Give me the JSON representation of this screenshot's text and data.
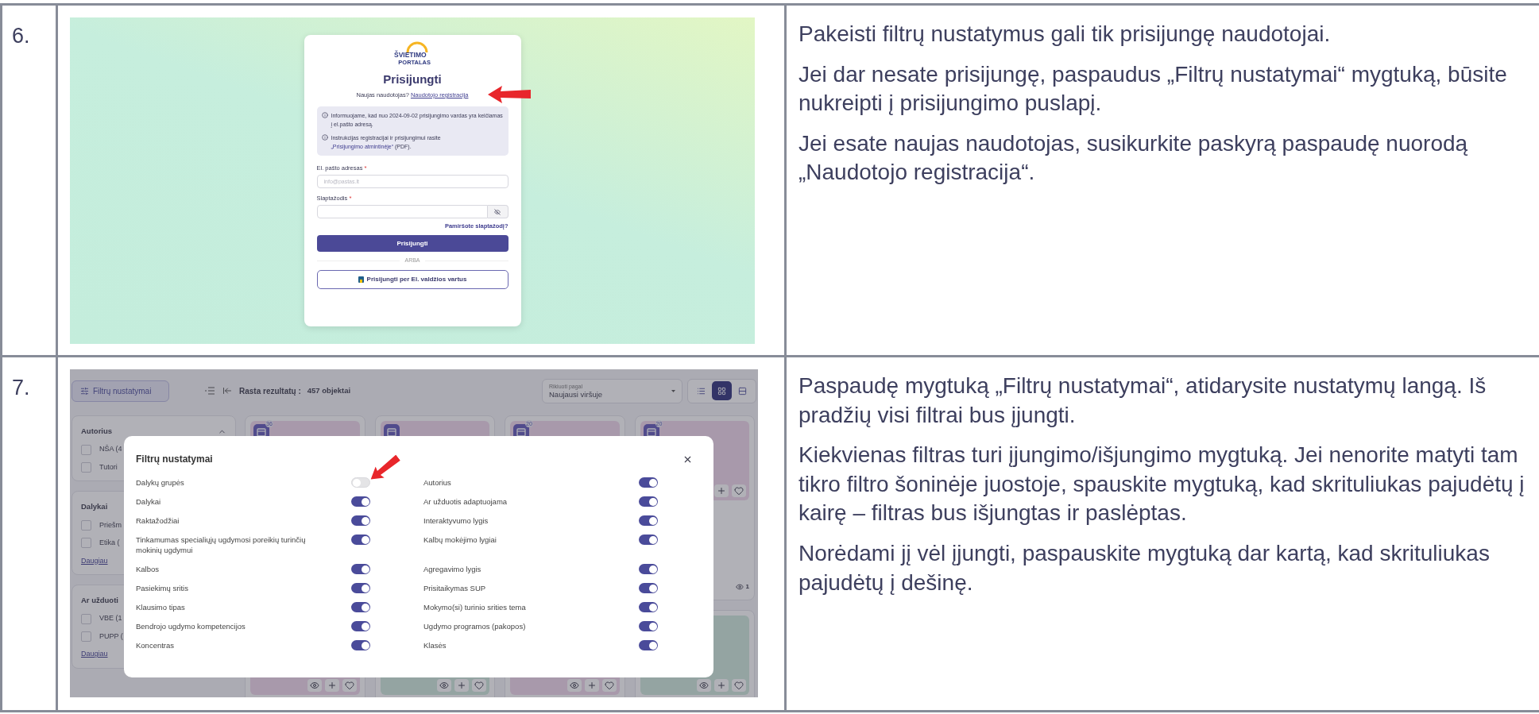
{
  "rows": [
    {
      "number": "6.",
      "screenshot": {
        "kind": "login",
        "logo": {
          "name": "ŠVIETIMO",
          "subtitle": "PORTALAS"
        },
        "title": "Prisijungti",
        "prompt": "Naujas naudotojas?",
        "register_link": "Naudotojo registracija",
        "notices": [
          {
            "text": "Informuojame, kad nuo 2024-09-02 prisijungimo vardas yra keičiamas į el.pašto adresą."
          },
          {
            "text": "Instrukcijas registracijai ir prisijungimui rasite ",
            "link": "„Prisijungimo atmintinėje“",
            "after": " (PDF)."
          }
        ],
        "email": {
          "label": "El. pašto adresas",
          "required_mark": "*",
          "placeholder": "info@pastas.lt"
        },
        "password": {
          "label": "Slaptažodis",
          "required_mark": "*"
        },
        "forgot_link": "Pamiršote slaptažodį?",
        "submit": "Prisijungti",
        "separator": "ARBA",
        "alt_login": "Prisijungti per El. valdžios vartus"
      },
      "paragraphs": [
        "Pakeisti filtrų nustatymus gali tik prisijungę naudotojai.",
        "Jei dar nesate prisijungę, paspaudus „Filtrų nustatymai“ mygtuką, būsite nukreipti į prisijungimo puslapį.",
        "Jei esate naujas naudotojas, susikurkite paskyrą paspaudę nuorodą „Naudotojo registracija“."
      ]
    },
    {
      "number": "7.",
      "screenshot": {
        "kind": "filter_settings",
        "filter_button": "Filtrų nustatymai",
        "results_label": "Rasta rezultatų :",
        "results_count": "457 objektai",
        "sort": {
          "label": "Rikiuoti pagal",
          "value": "Naujausi viršuje"
        },
        "view_buttons": [
          {
            "selected": false
          },
          {
            "selected": true
          },
          {
            "selected": false
          }
        ],
        "sidebar": [
          {
            "title": "Autorius",
            "options": [
              {
                "label": "NŠA (4",
                "checked": false
              },
              {
                "label": "Tutori",
                "checked": false
              }
            ]
          },
          {
            "title": "Dalykai",
            "options": [
              {
                "label": "Priešm",
                "checked": false
              },
              {
                "label": "Etika (",
                "checked": false
              }
            ],
            "more": "Daugiau"
          },
          {
            "title": "Ar užduoti",
            "options": [
              {
                "label": "VBE (1",
                "checked": false
              },
              {
                "label": "PUPP (",
                "checked": false
              }
            ],
            "more": "Daugiau"
          }
        ],
        "cards": [
          {
            "kind": "pink",
            "badge": "36"
          },
          {
            "kind": "pink"
          },
          {
            "kind": "pink",
            "badge": "20"
          },
          {
            "kind": "pink",
            "badge": "20",
            "views": "1"
          },
          {
            "kind": "pink"
          },
          {
            "kind": "green"
          },
          {
            "kind": "pink"
          },
          {
            "kind": "green"
          }
        ],
        "modal": {
          "title": "Filtrų nustatymai",
          "left": [
            {
              "label": "Dalykų grupės",
              "on": false
            },
            {
              "label": "Dalykai",
              "on": true
            },
            {
              "label": "Raktažodžiai",
              "on": true
            },
            {
              "label": "Tinkamumas specialiųjų ugdymosi poreikių turinčių mokinių ugdymui",
              "on": true
            },
            {
              "label": "Kalbos",
              "on": true
            },
            {
              "label": "Pasiekimų sritis",
              "on": true
            },
            {
              "label": "Klausimo tipas",
              "on": true
            },
            {
              "label": "Bendrojo ugdymo kompetencijos",
              "on": true
            },
            {
              "label": "Koncentras",
              "on": true
            }
          ],
          "right": [
            {
              "label": "Autorius",
              "on": true
            },
            {
              "label": "Ar užduotis adaptuojama",
              "on": true
            },
            {
              "label": "Interaktyvumo lygis",
              "on": true
            },
            {
              "label": "Kalbų mokėjimo lygiai",
              "on": true
            },
            {
              "label": "Agregavimo lygis",
              "on": true
            },
            {
              "label": "Prisitaikymas SUP",
              "on": true
            },
            {
              "label": "Mokymo(si) turinio srities tema",
              "on": true
            },
            {
              "label": "Ugdymo programos (pakopos)",
              "on": true
            },
            {
              "label": "Klasės",
              "on": true
            }
          ]
        }
      },
      "paragraphs": [
        "Paspaudę mygtuką „Filtrų nustatymai“, atidarysite nustatymų langą. Iš pradžių visi filtrai bus įjungti.",
        "Kiekvienas filtras turi įjungimo/išjungimo mygtuką. Jei nenorite matyti tam tikro filtro šoninėje juostoje, spauskite mygtuką, kad skrituliukas pajudėtų į kairę – filtras bus išjungtas ir paslėptas.",
        "Norėdami jį vėl įjungti, paspauskite mygtuką dar kartą, kad skrituliukas pajudėtų į dešinę."
      ]
    }
  ]
}
